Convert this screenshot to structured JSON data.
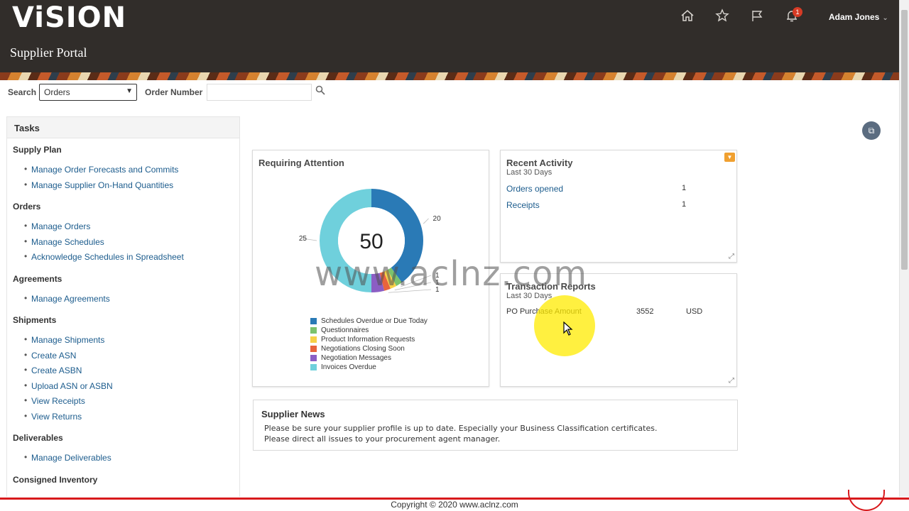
{
  "header": {
    "logo": "ViSION",
    "portal_title": "Supplier Portal",
    "icons": [
      "home-icon",
      "star-icon",
      "flag-icon",
      "bell-icon"
    ],
    "notification_count": "1",
    "user_name": "Adam Jones"
  },
  "search": {
    "label": "Search",
    "selected": "Orders",
    "order_number_label": "Order Number",
    "order_number_value": ""
  },
  "tasks": {
    "title": "Tasks",
    "groups": [
      {
        "title": "Supply Plan",
        "items": [
          "Manage Order Forecasts and Commits",
          "Manage Supplier On-Hand Quantities"
        ]
      },
      {
        "title": "Orders",
        "items": [
          "Manage Orders",
          "Manage Schedules",
          "Acknowledge Schedules in Spreadsheet"
        ]
      },
      {
        "title": "Agreements",
        "items": [
          "Manage Agreements"
        ]
      },
      {
        "title": "Shipments",
        "items": [
          "Manage Shipments",
          "Create ASN",
          "Create ASBN",
          "Upload ASN or ASBN",
          "View Receipts",
          "View Returns"
        ]
      },
      {
        "title": "Deliverables",
        "items": [
          "Manage Deliverables"
        ]
      },
      {
        "title": "Consigned Inventory",
        "items": []
      }
    ]
  },
  "requiring_attention": {
    "title": "Requiring Attention",
    "total": "50",
    "segments": [
      {
        "label": "Schedules Overdue or Due Today",
        "value": 20,
        "display": "20",
        "color": "#2a7ab6"
      },
      {
        "label": "Questionnaires",
        "value": 1,
        "display": "1",
        "color": "#7cc36d"
      },
      {
        "label": "Product Information Requests",
        "value": 1,
        "display": "1",
        "color": "#f7d147"
      },
      {
        "label": "Negotiations Closing Soon",
        "value": 1,
        "display": "1",
        "color": "#e8643c"
      },
      {
        "label": "Negotiation Messages",
        "value": 2,
        "display": "",
        "color": "#8b5ec4"
      },
      {
        "label": "Invoices Overdue",
        "value": 25,
        "display": "25",
        "color": "#6fd0dc"
      }
    ]
  },
  "recent_activity": {
    "title": "Recent Activity",
    "subtitle": "Last 30 Days",
    "rows": [
      {
        "label": "Orders opened",
        "value": "1"
      },
      {
        "label": "Receipts",
        "value": "1"
      }
    ]
  },
  "transaction_reports": {
    "title": "Transaction Reports",
    "subtitle": "Last 30 Days",
    "row": {
      "label": "PO Purchase Amount",
      "value": "3552",
      "currency": "USD"
    }
  },
  "news": {
    "title": "Supplier News",
    "lines": [
      "Please be sure your supplier profile is up to date.  Especially your Business Classification certificates.",
      "Please direct all issues to your procurement agent manager."
    ]
  },
  "watermark": "www.aclnz.com",
  "footer": "Copyright © 2020 www.aclnz.com"
}
